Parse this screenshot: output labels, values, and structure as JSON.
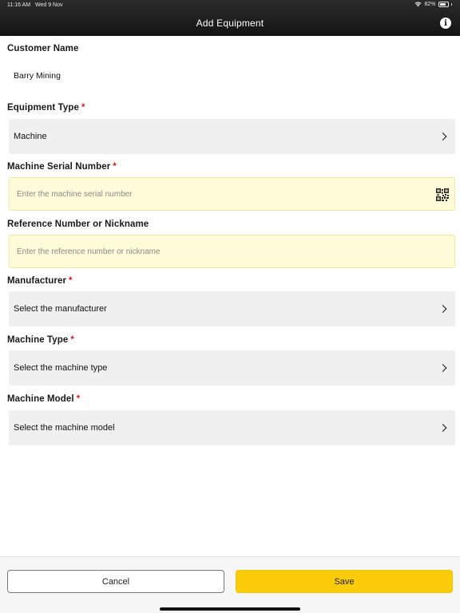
{
  "status_bar": {
    "time": "11:16 AM",
    "date": "Wed 9 Nov",
    "battery": "82%",
    "battery_level": 0.82
  },
  "header": {
    "title": "Add Equipment",
    "info_icon": "info-icon"
  },
  "form": {
    "customer_name": {
      "label": "Customer Name",
      "value": "Barry Mining"
    },
    "equipment_type": {
      "label": "Equipment Type",
      "required": "*",
      "value": "Machine"
    },
    "serial_number": {
      "label": "Machine Serial Number",
      "required": "*",
      "placeholder": "Enter the machine serial number",
      "value": "",
      "icon": "qr-code-icon"
    },
    "reference_number": {
      "label": "Reference Number or Nickname",
      "placeholder": "Enter the reference number or nickname",
      "value": ""
    },
    "manufacturer": {
      "label": "Manufacturer",
      "required": "*",
      "value": "Select the manufacturer"
    },
    "machine_type": {
      "label": "Machine Type",
      "required": "*",
      "value": "Select the machine type"
    },
    "machine_model": {
      "label": "Machine Model",
      "required": "*",
      "value": "Select the machine model"
    }
  },
  "footer": {
    "cancel_label": "Cancel",
    "save_label": "Save"
  },
  "colors": {
    "header_bg": "#1c1c1c",
    "save_button": "#fccc0a",
    "required": "#d01f1f",
    "input_bg": "#fdfbd8",
    "select_bg": "#f0f0f0"
  }
}
